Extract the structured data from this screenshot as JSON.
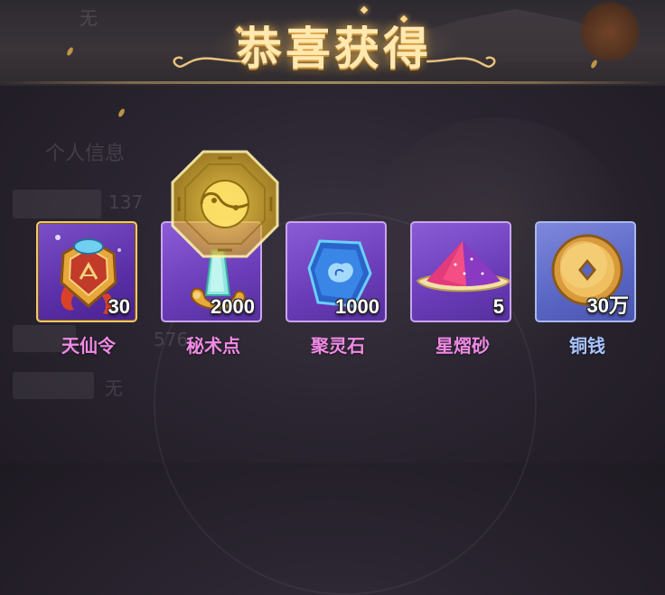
{
  "banner": {
    "title": "恭喜获得"
  },
  "background": {
    "top_left_text": "无",
    "section_title": "个人信息",
    "level_value": "137",
    "number_fragment": "576",
    "bottom_value": "无"
  },
  "items": [
    {
      "name": "天仙令",
      "count": "30",
      "icon": "heavenly-token-icon",
      "rarity": "gold"
    },
    {
      "name": "秘术点",
      "count": "2000",
      "icon": "secret-art-crystal-icon",
      "rarity": "purple"
    },
    {
      "name": "聚灵石",
      "count": "1000",
      "icon": "spirit-stone-icon",
      "rarity": "purple"
    },
    {
      "name": "星熠砂",
      "count": "5",
      "icon": "star-sand-icon",
      "rarity": "purple"
    },
    {
      "name": "铜钱",
      "count": "30万",
      "icon": "copper-coin-icon",
      "rarity": "blue"
    }
  ],
  "colors": {
    "title_gold": "#ffe9b0",
    "label_pink": "#f08ae6",
    "label_blue": "#a8c4ff",
    "frame_gold": "#f2c86a"
  }
}
